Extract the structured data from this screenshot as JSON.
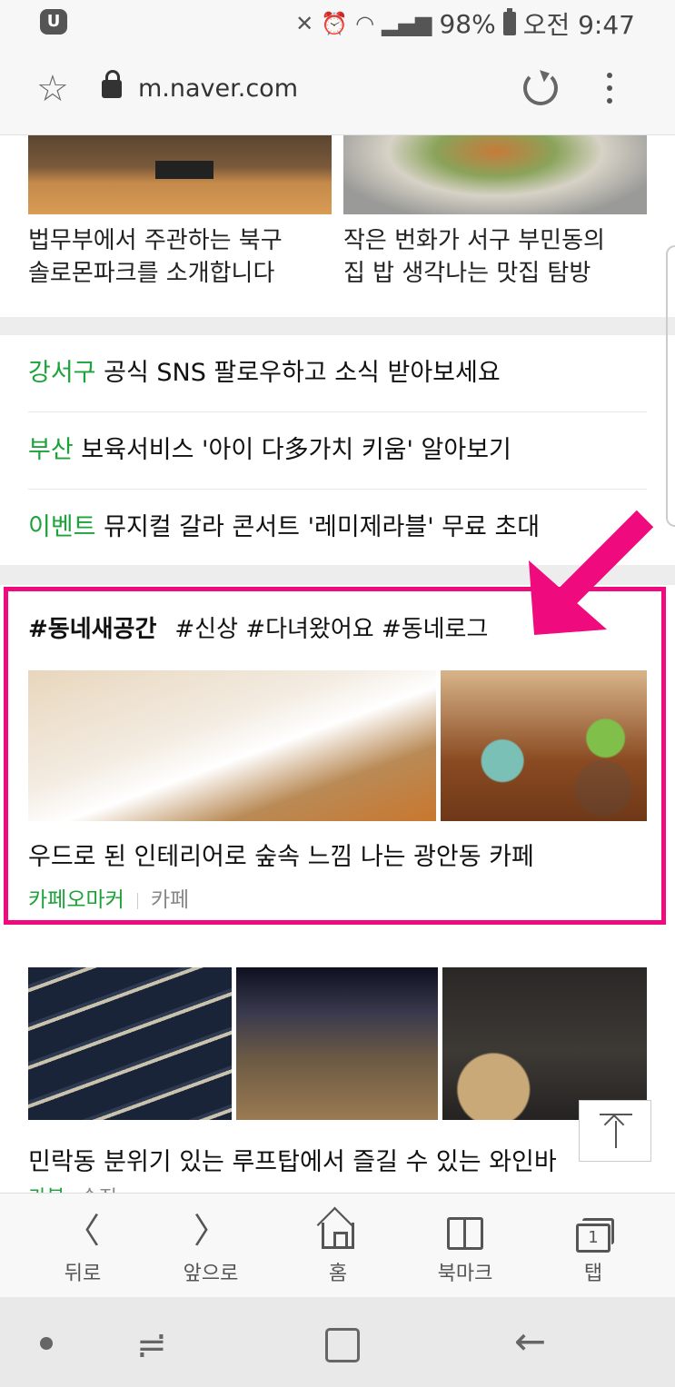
{
  "status_bar": {
    "app_icon": "U",
    "battery": "98%",
    "time": "오전 9:47"
  },
  "address_bar": {
    "url": "m.naver.com"
  },
  "top_cards": [
    {
      "caption_line1": "법무부에서 주관하는 북구",
      "caption_line2": "솔로몬파크를 소개합니다"
    },
    {
      "caption_line1": "작은 번화가 서구 부민동의",
      "caption_line2": "집 밥 생각나는 맛집 탐방"
    }
  ],
  "news": [
    {
      "keyword": "강서구",
      "text": " 공식 SNS 팔로우하고 소식 받아보세요"
    },
    {
      "keyword": "부산",
      "text": " 보육서비스 '아이 다多가치 키움' 알아보기"
    },
    {
      "keyword": "이벤트",
      "text": " 뮤지컬 갈라 콘서트 '레미제라블' 무료 초대"
    }
  ],
  "section": {
    "main_tag": "#동네새공간",
    "other_tags": "#신상 #다녀왔어요 #동네로그"
  },
  "cafe_post": {
    "title": "우드로 된 인테리어로 숲속 느낌 나는 광안동 카페",
    "source": "카페오마커",
    "category": "카페"
  },
  "wine_post": {
    "title": "민락동 분위기 있는 루프탑에서 즐길 수 있는 와인바",
    "source": "카블",
    "category": "숙집"
  },
  "bottom_nav": {
    "back": "뒤로",
    "forward": "앞으로",
    "home": "홈",
    "bookmark": "북마크",
    "tabs": "탭",
    "tab_count": "1"
  },
  "colors": {
    "accent_green": "#1ba33a",
    "highlight_pink": "#ef0a7e"
  }
}
